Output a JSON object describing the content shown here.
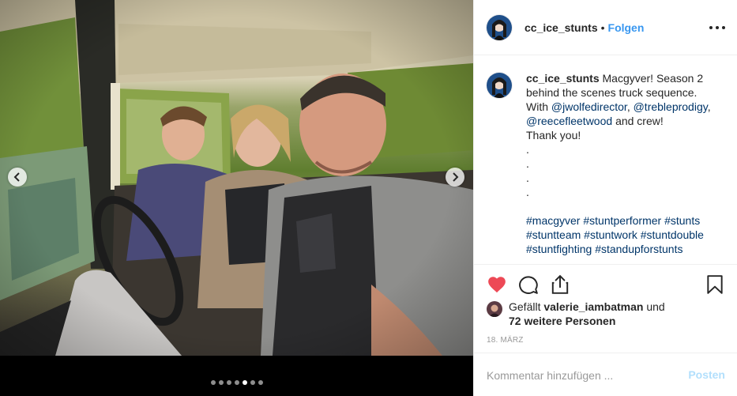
{
  "post": {
    "username": "cc_ice_stunts",
    "separator": "•",
    "follow_label": "Folgen",
    "caption_lines": [
      "behind the scenes truck sequence.",
      "With ",
      "and crew!",
      "Thank you!",
      ".",
      ".",
      ".",
      "."
    ],
    "caption_intro": "Macgyver! Season 2",
    "mentions": [
      "@jwolfedirector",
      "@trebleprodigy",
      "@reecefleetwood"
    ],
    "mention_sep": ", ",
    "hashtags": [
      "#macgyver",
      "#stuntperformer",
      "#stunts",
      "#stuntteam",
      "#stuntwork",
      "#stuntdouble",
      "#stuntfighting",
      "#standupforstunts"
    ],
    "likes_prefix": "Gefällt ",
    "liked_by": "valerie_iambatman",
    "likes_and": " und",
    "likes_others": "72 weitere Personen",
    "date": "18. MÄRZ",
    "comment_placeholder": "Kommentar hinzufügen ...",
    "post_button_label": "Posten"
  },
  "carousel": {
    "slide_count": 7,
    "active_index": 4
  },
  "colors": {
    "link_blue": "#3897f0",
    "mention_blue": "#003569",
    "like_red": "#ed4956",
    "muted": "#999999",
    "post_disabled": "#b2dffc"
  },
  "icons": {
    "like": "heart-icon",
    "comment": "comment-bubble-icon",
    "share": "share-icon",
    "save": "bookmark-icon",
    "more": "more-dots-icon",
    "prev": "chevron-left-icon",
    "next": "chevron-right-icon"
  }
}
